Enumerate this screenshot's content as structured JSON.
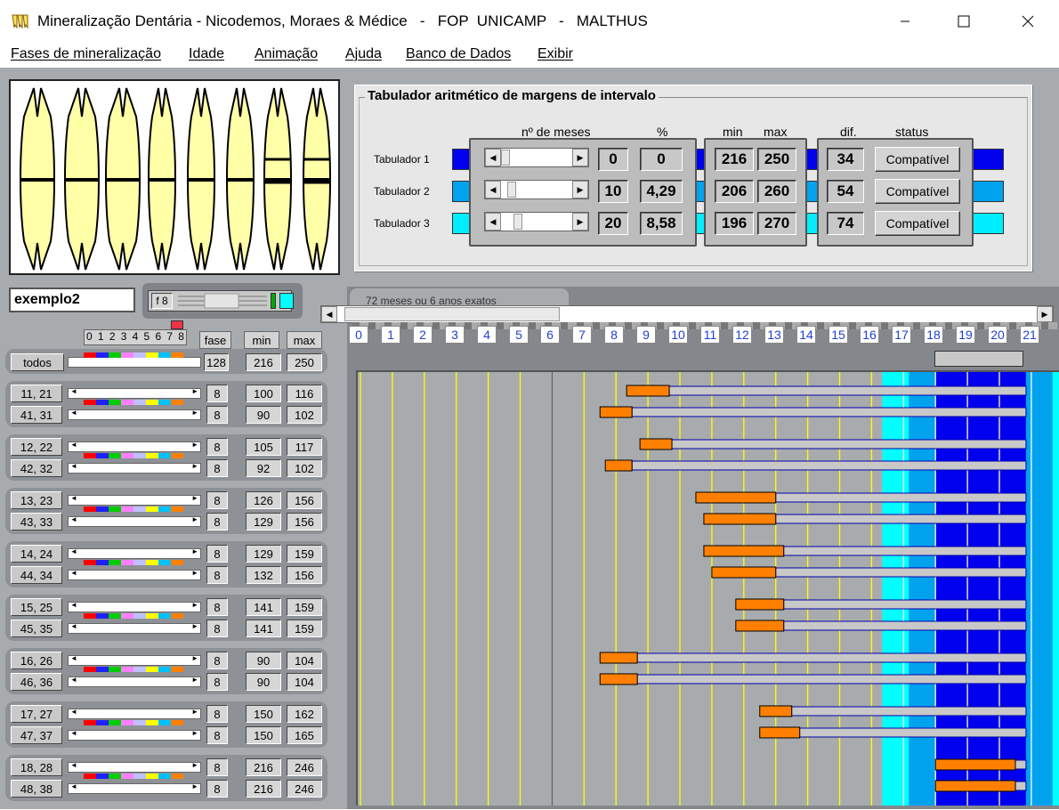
{
  "window": {
    "title": "Mineralização Dentária - Nicodemos, Moraes & Médice   -   FOP  UNICAMP   -   MALTHUS",
    "app_icon": "teeth-icon",
    "controls": {
      "minimize": "—",
      "maximize": "☐",
      "close": "✕"
    }
  },
  "menu": [
    "Fases de mineralização",
    "Idade",
    "Animação",
    "Ajuda",
    "Banco de Dados",
    "Exibir"
  ],
  "tabulador": {
    "title": "Tabulador aritmético de margens de intervalo",
    "headers": {
      "meses": "nº de meses",
      "pct": "%",
      "min": "min",
      "max": "max",
      "dif": "dif.",
      "status": "status"
    },
    "rows": [
      {
        "label": "Tabulador 1",
        "meses": "0",
        "pct": "0",
        "min": "216",
        "max": "250",
        "dif": "34",
        "status": "Compatível",
        "color": "#0000ee",
        "slider": 0
      },
      {
        "label": "Tabulador 2",
        "meses": "10",
        "pct": "4,29",
        "min": "206",
        "max": "260",
        "dif": "54",
        "status": "Compatível",
        "color": "#00a2ee",
        "slider": 10
      },
      {
        "label": "Tabulador 3",
        "meses": "20",
        "pct": "8,58",
        "min": "196",
        "max": "270",
        "dif": "74",
        "status": "Compatível",
        "color": "#00eeff",
        "slider": 20
      }
    ]
  },
  "project": {
    "name": "exemplo2",
    "f_label": "f 8",
    "accent_color": "#00ffff"
  },
  "timeline": {
    "tab_label": "72 meses ou 6 anos exatos",
    "ticks": [
      "0",
      "1",
      "2",
      "3",
      "4",
      "5",
      "6",
      "7",
      "8",
      "9",
      "10",
      "11",
      "12",
      "13",
      "14",
      "15",
      "16",
      "17",
      "18",
      "19",
      "20",
      "21"
    ]
  },
  "left_header": {
    "phases": "0 1 2 3 4 5 6 7 8",
    "fase": "fase",
    "min": "min",
    "max": "max"
  },
  "todos": {
    "label": "todos",
    "fase": "128",
    "min": "216",
    "max": "250"
  },
  "palette": [
    "#ff0000",
    "#2020ff",
    "#00cc00",
    "#ff80ff",
    "#c0c0ff",
    "#ffff00",
    "#00c0ff",
    "#ff8000"
  ],
  "teeth_rows": [
    {
      "label": "11, 21",
      "fase": "8",
      "min": "100",
      "max": "116",
      "bar_start": 100,
      "bar_end": 116
    },
    {
      "label": "41, 31",
      "fase": "8",
      "min": "90",
      "max": "102",
      "bar_start": 90,
      "bar_end": 102
    },
    {
      "label": "12, 22",
      "fase": "8",
      "min": "105",
      "max": "117",
      "bar_start": 105,
      "bar_end": 117
    },
    {
      "label": "42, 32",
      "fase": "8",
      "min": "92",
      "max": "102",
      "bar_start": 92,
      "bar_end": 102
    },
    {
      "label": "13, 23",
      "fase": "8",
      "min": "126",
      "max": "156",
      "bar_start": 126,
      "bar_end": 156
    },
    {
      "label": "43, 33",
      "fase": "8",
      "min": "129",
      "max": "156",
      "bar_start": 129,
      "bar_end": 156
    },
    {
      "label": "14, 24",
      "fase": "8",
      "min": "129",
      "max": "159",
      "bar_start": 129,
      "bar_end": 159
    },
    {
      "label": "44, 34",
      "fase": "8",
      "min": "132",
      "max": "156",
      "bar_start": 132,
      "bar_end": 156
    },
    {
      "label": "15, 25",
      "fase": "8",
      "min": "141",
      "max": "159",
      "bar_start": 141,
      "bar_end": 159
    },
    {
      "label": "45, 35",
      "fase": "8",
      "min": "141",
      "max": "159",
      "bar_start": 141,
      "bar_end": 159
    },
    {
      "label": "16, 26",
      "fase": "8",
      "min": "90",
      "max": "104",
      "bar_start": 90,
      "bar_end": 104
    },
    {
      "label": "46, 36",
      "fase": "8",
      "min": "90",
      "max": "104",
      "bar_start": 90,
      "bar_end": 104
    },
    {
      "label": "17, 27",
      "fase": "8",
      "min": "150",
      "max": "162",
      "bar_start": 150,
      "bar_end": 162
    },
    {
      "label": "47, 37",
      "fase": "8",
      "min": "150",
      "max": "165",
      "bar_start": 150,
      "bar_end": 165
    },
    {
      "label": "18, 28",
      "fase": "8",
      "min": "216",
      "max": "246",
      "bar_start": 216,
      "bar_end": 246
    },
    {
      "label": "48, 38",
      "fase": "8",
      "min": "216",
      "max": "246",
      "bar_start": 216,
      "bar_end": 246
    }
  ],
  "colors": {
    "bar_orange": "#ff8000",
    "bar_grey": "#c8c8c8",
    "grid_yellow": "#ffff00",
    "zone_cyan": "#00ffff",
    "zone_light": "#00a2ee",
    "zone_blue": "#0000ee"
  }
}
